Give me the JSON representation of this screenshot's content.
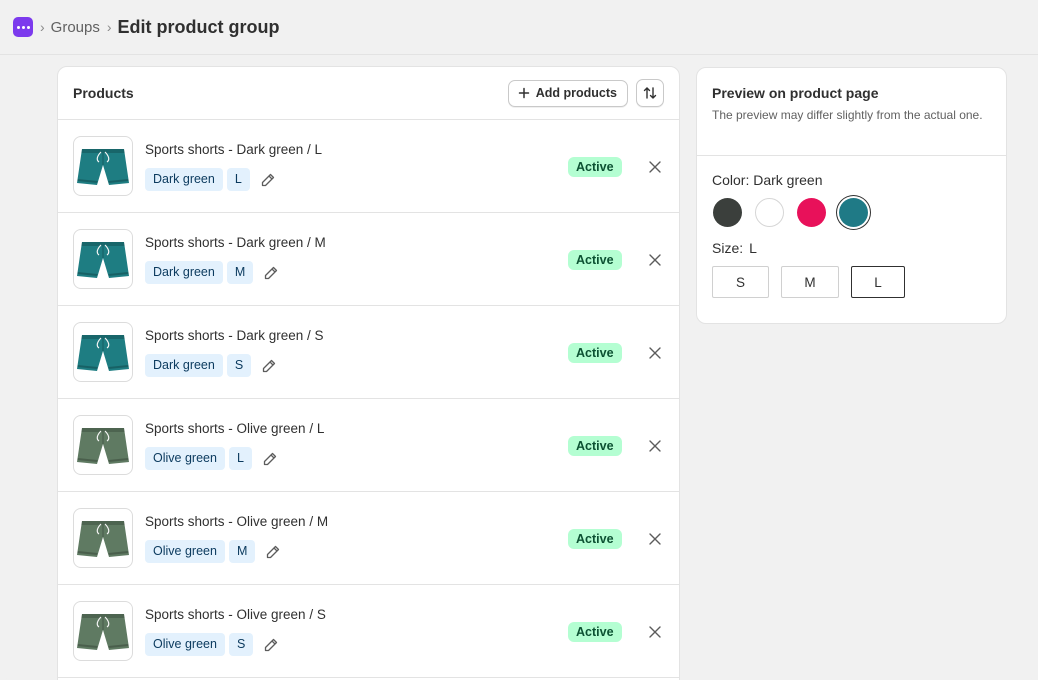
{
  "breadcrumb": {
    "parent": "Groups",
    "separator": "›",
    "title": "Edit product group"
  },
  "products_card": {
    "title": "Products",
    "add_button_label": "Add products",
    "rows": [
      {
        "title": "Sports shorts - Dark green / L",
        "color": "Dark green",
        "size": "L",
        "status": "Active",
        "image": "teal-shorts"
      },
      {
        "title": "Sports shorts - Dark green / M",
        "color": "Dark green",
        "size": "M",
        "status": "Active",
        "image": "teal-shorts"
      },
      {
        "title": "Sports shorts - Dark green / S",
        "color": "Dark green",
        "size": "S",
        "status": "Active",
        "image": "teal-shorts"
      },
      {
        "title": "Sports shorts - Olive green / L",
        "color": "Olive green",
        "size": "L",
        "status": "Active",
        "image": "olive-shorts"
      },
      {
        "title": "Sports shorts - Olive green / M",
        "color": "Olive green",
        "size": "M",
        "status": "Active",
        "image": "olive-shorts"
      },
      {
        "title": "Sports shorts - Olive green / S",
        "color": "Olive green",
        "size": "S",
        "status": "Active",
        "image": "olive-shorts"
      }
    ]
  },
  "preview": {
    "title": "Preview on product page",
    "subtitle": "The preview may differ slightly from the actual one.",
    "color_label": "Color: Dark green",
    "swatches": [
      {
        "name": "Charcoal",
        "hex": "#3b3f3c",
        "selected": false
      },
      {
        "name": "White",
        "hex": "#ffffff",
        "selected": false
      },
      {
        "name": "Pink",
        "hex": "#e8115a",
        "selected": false
      },
      {
        "name": "Dark green",
        "hex": "#1f7a86",
        "selected": true
      }
    ],
    "size_label": "Size:",
    "size_value": "L",
    "sizes": [
      "S",
      "M",
      "L"
    ],
    "selected_size": "L"
  },
  "colors": {
    "accent": "#7c3aed",
    "badge_bg": "#b4fed2",
    "badge_text": "#0c5132",
    "tag_bg": "#e3f1fd",
    "teal_shorts": "#1e7d82",
    "olive_shorts": "#5f7a62"
  },
  "icons": {
    "app": "app-dots-icon",
    "add": "plus-icon",
    "sort": "sort-arrows-icon",
    "edit": "pencil-icon",
    "remove": "close-icon"
  }
}
